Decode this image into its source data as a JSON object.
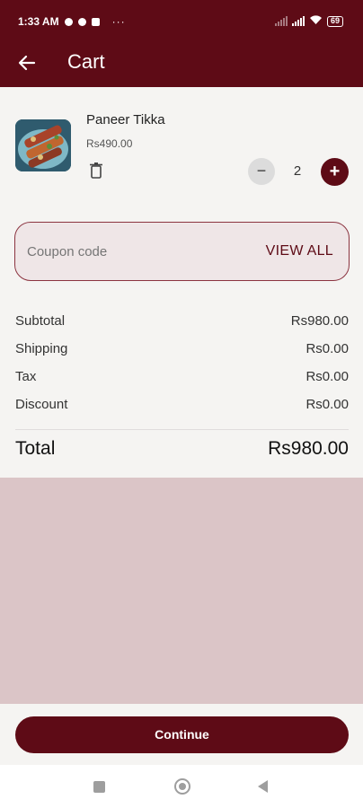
{
  "status_bar": {
    "time": "1:33 AM",
    "dots": "···",
    "battery": "69"
  },
  "app_bar": {
    "title": "Cart",
    "back_icon": "arrow-left-icon"
  },
  "cart": {
    "items": [
      {
        "name": "Paneer Tikka",
        "price": "Rs490.00",
        "quantity": "2"
      }
    ],
    "qty_minus": "−",
    "qty_plus": "+"
  },
  "coupon": {
    "placeholder": "Coupon code",
    "action": "VIEW ALL"
  },
  "summary": {
    "subtotal_label": "Subtotal",
    "subtotal_value": "Rs980.00",
    "shipping_label": "Shipping",
    "shipping_value": "Rs0.00",
    "tax_label": "Tax",
    "tax_value": "Rs0.00",
    "discount_label": "Discount",
    "discount_value": "Rs0.00",
    "total_label": "Total",
    "total_value": "Rs980.00"
  },
  "footer": {
    "continue_label": "Continue"
  },
  "colors": {
    "primary": "#5e0b16",
    "page_bg": "#f5f4f2",
    "empty_area": "#dbc5c7",
    "coupon_bg": "#efe6e7"
  }
}
